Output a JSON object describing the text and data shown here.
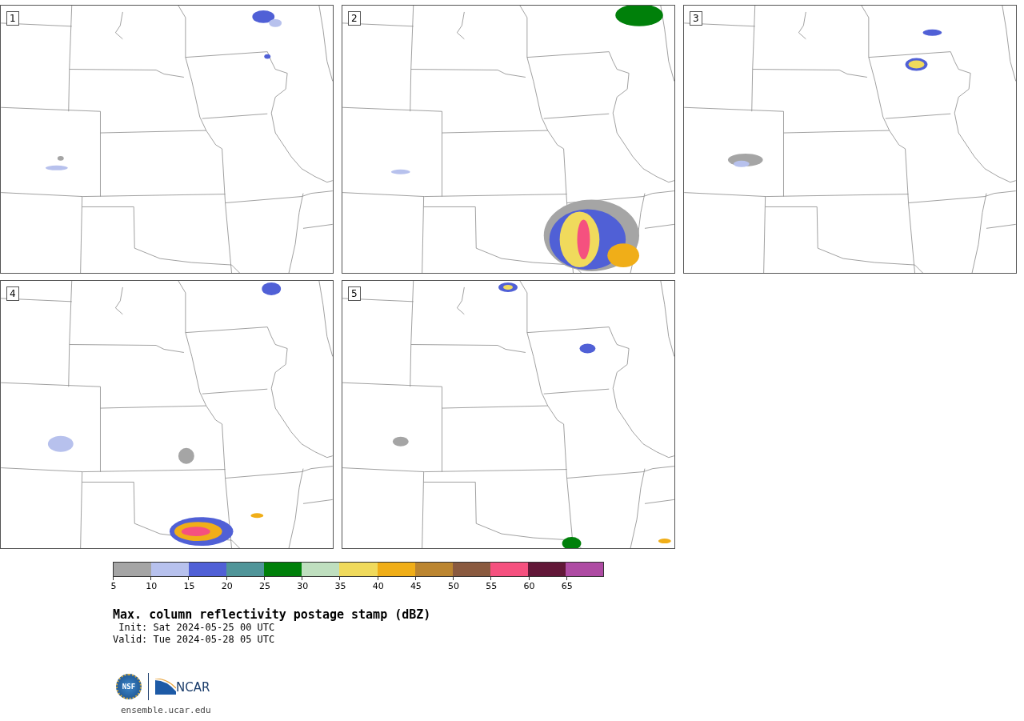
{
  "panels": [
    {
      "number": "1"
    },
    {
      "number": "2"
    },
    {
      "number": "3"
    },
    {
      "number": "4"
    },
    {
      "number": "5"
    }
  ],
  "colorbar": {
    "segments": [
      {
        "color": "#a5a5a5"
      },
      {
        "color": "#b7c1ed"
      },
      {
        "color": "#5060d6"
      },
      {
        "color": "#509599"
      },
      {
        "color": "#00800a"
      },
      {
        "color": "#bfdfbf"
      },
      {
        "color": "#f0da5c"
      },
      {
        "color": "#f0ae18"
      },
      {
        "color": "#bb8530"
      },
      {
        "color": "#8a5a3f"
      },
      {
        "color": "#f5517f"
      },
      {
        "color": "#621838"
      },
      {
        "color": "#ae4ba3"
      }
    ],
    "ticks": [
      "5",
      "10",
      "15",
      "20",
      "25",
      "30",
      "35",
      "40",
      "45",
      "50",
      "55",
      "60",
      "65"
    ]
  },
  "title": "Max. column reflectivity postage stamp (dBZ)",
  "init": " Init: Sat 2024-05-25 00 UTC",
  "valid": "Valid: Tue 2024-05-28 05 UTC",
  "logos": {
    "nsf": "NSF",
    "ncar": "NCAR"
  },
  "url": "ensemble.ucar.edu"
}
